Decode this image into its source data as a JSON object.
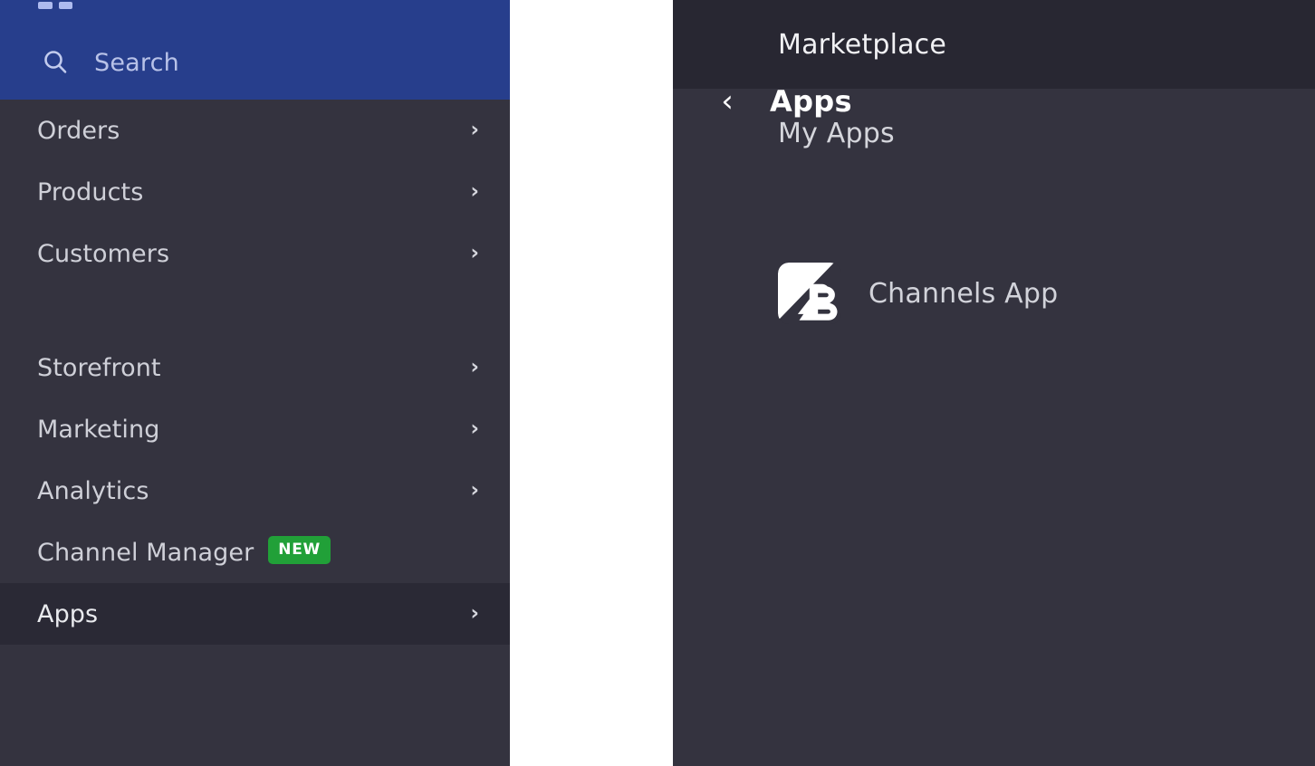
{
  "colors": {
    "brand_blue": "#273e8c",
    "sidebar_bg": "#34333f",
    "sidebar_active": "#2a2935",
    "panel_active": "#282732",
    "badge_green": "#21a038",
    "text_primary": "#ffffff",
    "text_muted": "#cfd0d8",
    "search_text": "#b8c2e8"
  },
  "sidebar": {
    "grid_icon": "app-grid-icon",
    "search": {
      "icon": "search-icon",
      "placeholder": "Search"
    },
    "groups": [
      {
        "items": [
          {
            "label": "Orders",
            "chevron": "›",
            "active": false
          },
          {
            "label": "Products",
            "chevron": "›",
            "active": false
          },
          {
            "label": "Customers",
            "chevron": "›",
            "active": false
          }
        ]
      },
      {
        "items": [
          {
            "label": "Storefront",
            "chevron": "›",
            "active": false
          },
          {
            "label": "Marketing",
            "chevron": "›",
            "active": false
          },
          {
            "label": "Analytics",
            "chevron": "›",
            "active": false
          },
          {
            "label": "Channel Manager",
            "badge": "NEW",
            "active": false
          },
          {
            "label": "Apps",
            "chevron": "›",
            "active": true
          }
        ]
      }
    ]
  },
  "panel": {
    "back_icon": "‹",
    "title": "Apps",
    "items": [
      {
        "label": "Marketplace",
        "active": true
      },
      {
        "label": "My Apps",
        "active": false
      }
    ],
    "app": {
      "icon": "bigcommerce-logo-icon",
      "label": "Channels App"
    }
  }
}
